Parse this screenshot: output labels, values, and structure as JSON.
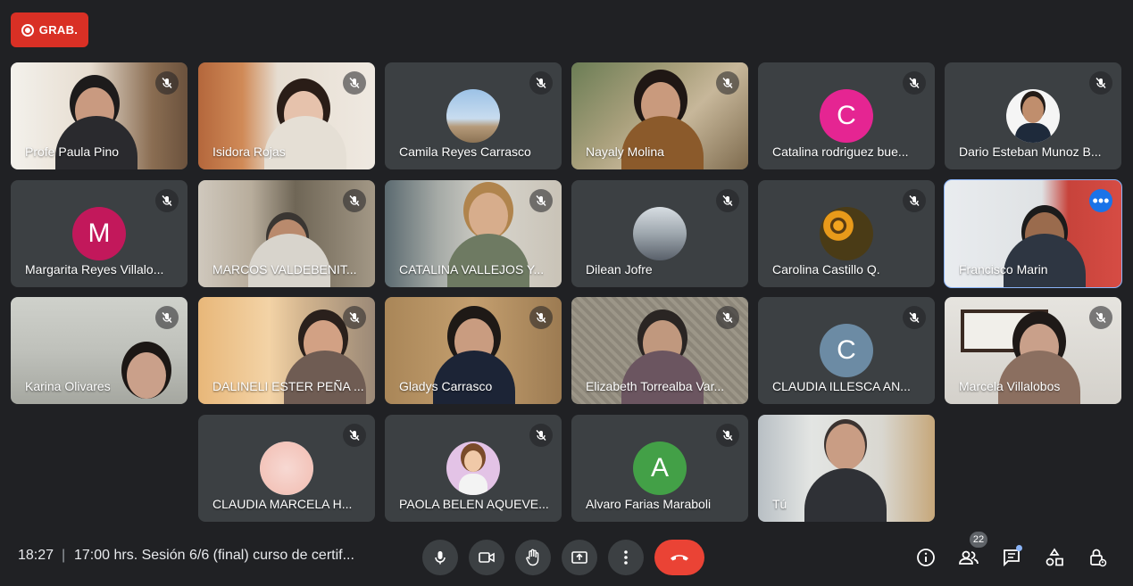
{
  "recording": {
    "label": "GRAB."
  },
  "participants": [
    {
      "name": "Profe Paula Pino",
      "kind": "video",
      "muted": true
    },
    {
      "name": "Isidora Rojas",
      "kind": "video",
      "muted": true
    },
    {
      "name": "Camila Reyes Carrasco",
      "kind": "photo",
      "muted": true
    },
    {
      "name": "Nayaly Molina",
      "kind": "video",
      "muted": true
    },
    {
      "name": "Catalina rodriguez bue...",
      "kind": "letter",
      "letter": "C",
      "color": "#e52592",
      "muted": true
    },
    {
      "name": "Dario Esteban Munoz B...",
      "kind": "photo",
      "muted": true
    },
    {
      "name": "Margarita Reyes Villalo...",
      "kind": "letter",
      "letter": "M",
      "color": "#c2185b",
      "muted": true
    },
    {
      "name": "MARCOS VALDEBENIT...",
      "kind": "video",
      "muted": true
    },
    {
      "name": "CATALINA VALLEJOS Y...",
      "kind": "video",
      "muted": true
    },
    {
      "name": "Dilean Jofre",
      "kind": "photo",
      "muted": true
    },
    {
      "name": "Carolina Castillo Q.",
      "kind": "photo",
      "muted": true
    },
    {
      "name": "Francisco Marin",
      "kind": "video",
      "muted": false,
      "selected": true
    },
    {
      "name": "Karina Olivares",
      "kind": "video",
      "muted": true
    },
    {
      "name": "DALINELI ESTER PEÑA ...",
      "kind": "video",
      "muted": true
    },
    {
      "name": "Gladys Carrasco",
      "kind": "video",
      "muted": true
    },
    {
      "name": "Elizabeth Torrealba Var...",
      "kind": "video",
      "muted": true
    },
    {
      "name": "CLAUDIA ILLESCA AN...",
      "kind": "letter",
      "letter": "C",
      "color": "#6c8ba4",
      "muted": true
    },
    {
      "name": "Marcela Villalobos",
      "kind": "video",
      "muted": true
    },
    {
      "name": "CLAUDIA MARCELA H...",
      "kind": "photo",
      "muted": true
    },
    {
      "name": "PAOLA BELEN AQUEVE...",
      "kind": "photo",
      "muted": true
    },
    {
      "name": "Alvaro Farias Maraboli",
      "kind": "letter",
      "letter": "A",
      "color": "#43a047",
      "muted": true
    },
    {
      "name": "Tú",
      "kind": "video",
      "muted": false
    }
  ],
  "bottom_bar": {
    "time": "18:27",
    "separator": "|",
    "meeting_title": "17:00 hrs. Sesión 6/6 (final) curso de certif...",
    "people_count": "22"
  },
  "colors": {
    "background": "#202124",
    "tile": "#3c4043",
    "hangup": "#ea4335",
    "accent": "#8ab4f8",
    "record": "#d93025"
  }
}
